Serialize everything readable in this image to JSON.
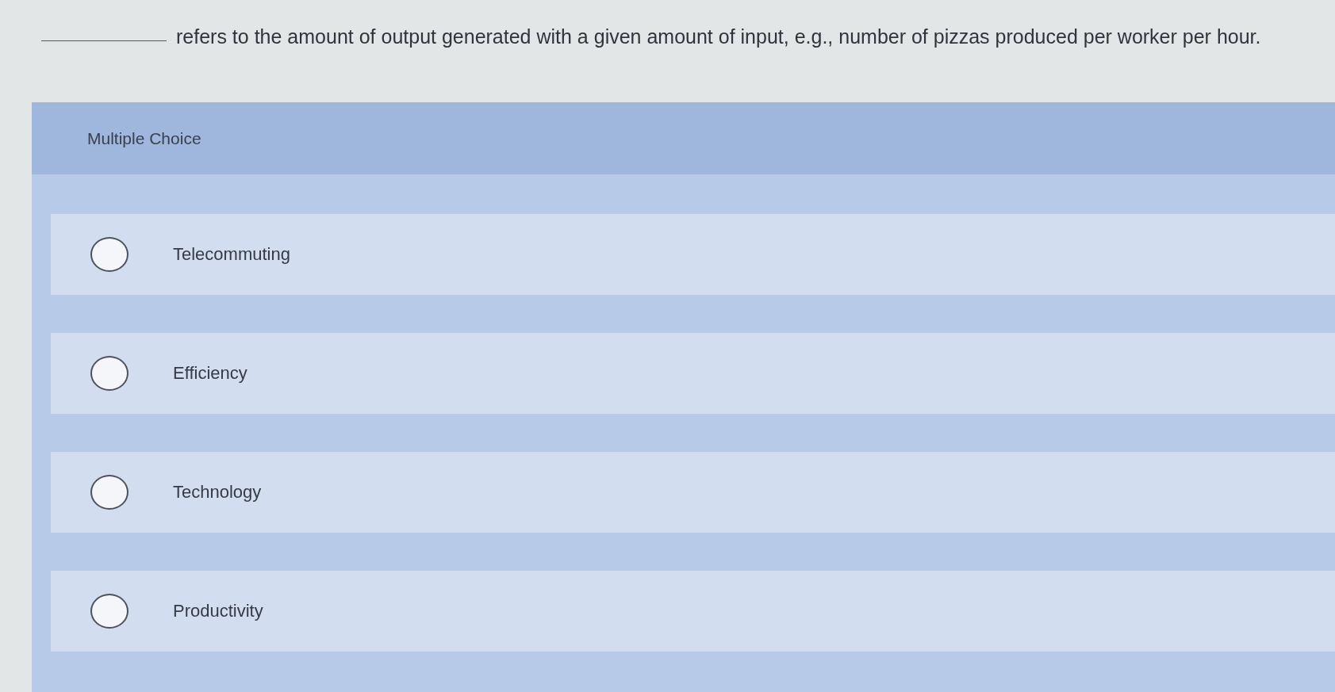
{
  "question": {
    "text": "refers to the amount of output generated with a given amount of input, e.g., number of pizzas produced per worker per hour."
  },
  "question_type": "Multiple Choice",
  "options": [
    {
      "label": "Telecommuting",
      "selected": false
    },
    {
      "label": "Efficiency",
      "selected": false
    },
    {
      "label": "Technology",
      "selected": false
    },
    {
      "label": "Productivity",
      "selected": false
    }
  ]
}
